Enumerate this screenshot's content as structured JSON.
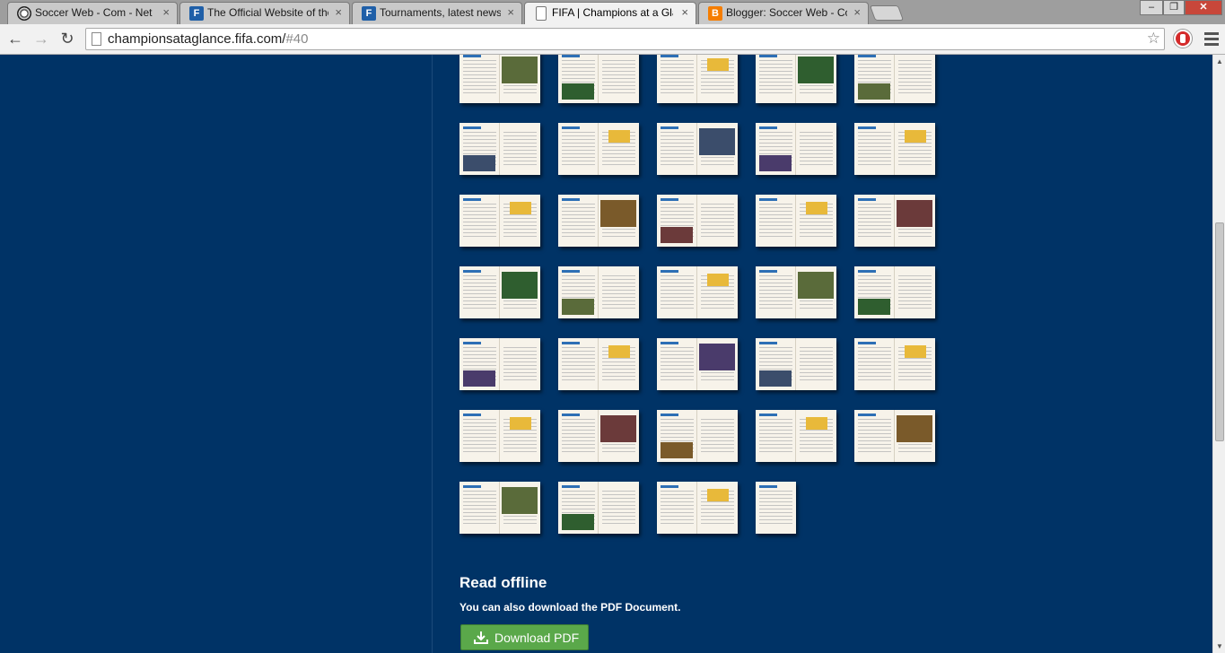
{
  "browser": {
    "tabs": [
      {
        "title": "Soccer Web - Com - Net",
        "icon": "soccer-ball-icon",
        "active": false
      },
      {
        "title": "The Official Website of the",
        "icon": "fifa-icon",
        "active": false
      },
      {
        "title": "Tournaments, latest news",
        "icon": "fifa-icon",
        "active": false
      },
      {
        "title": "FIFA | Champions at a Glance",
        "icon": "page-icon",
        "active": true
      },
      {
        "title": "Blogger: Soccer Web - Com",
        "icon": "blogger-icon",
        "active": false
      }
    ],
    "tab_close_glyph": "×",
    "window_controls": {
      "minimize": "–",
      "restore": "❐",
      "close": "✕"
    },
    "nav": {
      "back": "←",
      "forward": "→",
      "reload": "↻"
    },
    "address": {
      "domain": "championsataglance.fifa.com/",
      "path": "#40"
    },
    "star": "☆"
  },
  "thumbnails": {
    "rows": 7,
    "columns": 5,
    "count": 34
  },
  "offline": {
    "title": "Read offline",
    "text": "You can also download the PDF Document.",
    "button": "Download PDF"
  },
  "colors": {
    "page_bg": "#003366",
    "button_bg": "#5aa84a",
    "accent_blue": "#2d6fb5"
  }
}
